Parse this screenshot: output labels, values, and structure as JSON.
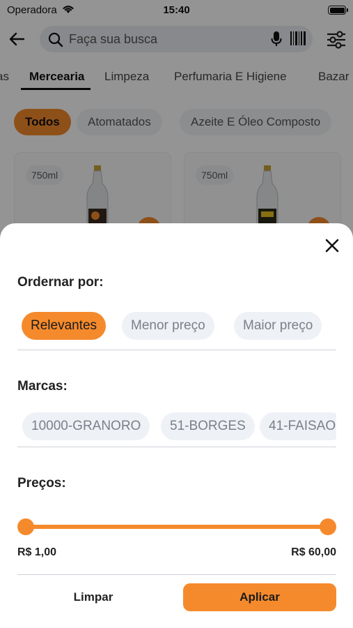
{
  "status_bar": {
    "carrier": "Operadora",
    "time": "15:40"
  },
  "search": {
    "placeholder": "Faça sua busca"
  },
  "categories": [
    "as",
    "Mercearia",
    "Limpeza",
    "Perfumaria E Higiene",
    "Bazar"
  ],
  "active_category": "Mercearia",
  "subcategories": [
    "Todos",
    "Atomatados",
    "Azeite E Óleo Composto"
  ],
  "products": [
    {
      "size": "750ml"
    },
    {
      "size": "750ml"
    }
  ],
  "filter_sheet": {
    "sort_title": "Ordernar por:",
    "sort_options": [
      {
        "label": "Relevantes",
        "selected": true
      },
      {
        "label": "Menor preço",
        "selected": false
      },
      {
        "label": "Maior preço",
        "selected": false
      }
    ],
    "brands_title": "Marcas:",
    "brands": [
      "10000-GRANORO",
      "51-BORGES",
      "41-FAISAO"
    ],
    "prices_title": "Preços:",
    "price_min": "R$ 1,00",
    "price_max": "R$ 60,00",
    "price_range_selected": [
      0,
      1
    ],
    "clear_label": "Limpar",
    "apply_label": "Aplicar"
  },
  "colors": {
    "accent": "#f58a2c",
    "chip_bg": "#eef1f5",
    "chip_text": "#7a7f8a"
  }
}
